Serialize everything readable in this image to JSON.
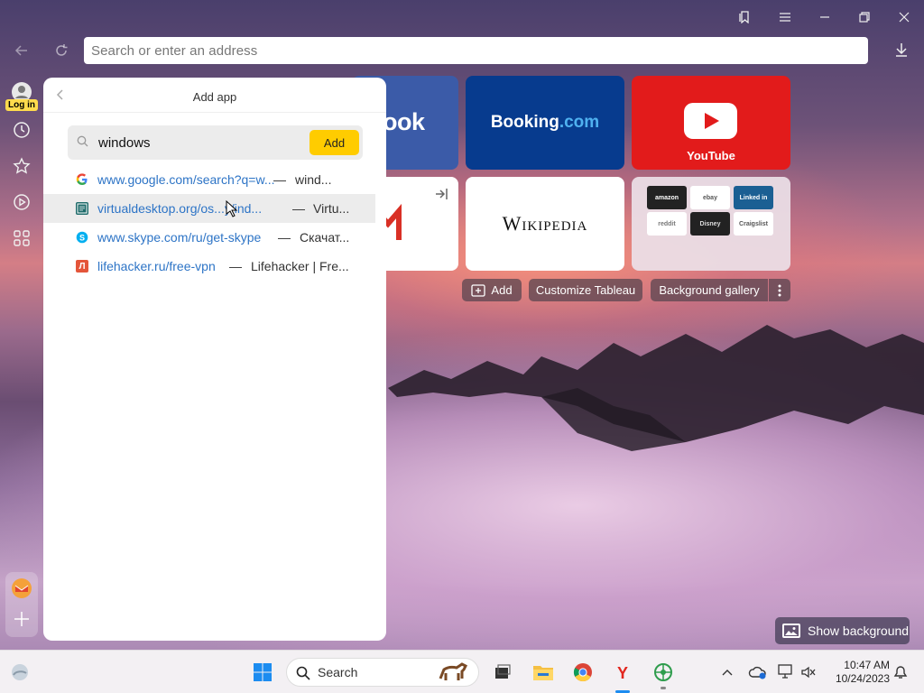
{
  "browser": {
    "address_placeholder": "Search or enter an address"
  },
  "sidebar": {
    "login_label": "Log in"
  },
  "tiles": {
    "facebook_text": "ook",
    "booking_main": "Booking",
    "booking_suffix": ".com",
    "youtube_label": "YouTube",
    "wikipedia_text": "Wikipedia",
    "multi": [
      "amazon",
      "ebay",
      "Linked in",
      "reddit",
      "Disney",
      "Craigslist"
    ]
  },
  "tableau": {
    "add_label": "Add",
    "customize_label": "Customize Tableau",
    "gallery_label": "Background gallery"
  },
  "panel": {
    "title": "Add app",
    "search_value": "windows",
    "add_button": "Add",
    "suggestions": [
      {
        "url": "www.google.com/search?q=w...",
        "desc": "wind..."
      },
      {
        "url": "virtualdesktop.org/os...y/ind...",
        "desc": "Virtu..."
      },
      {
        "url": "www.skype.com/ru/get-skype",
        "desc": "Скачат..."
      },
      {
        "url": "lifehacker.ru/free-vpn",
        "desc": "Lifehacker | Fre..."
      }
    ]
  },
  "show_background": "Show background",
  "taskbar": {
    "search_label": "Search",
    "time": "10:47 AM",
    "date": "10/24/2023"
  },
  "colors": {
    "accent_yellow": "#ffcc00",
    "link_blue": "#2d74c6",
    "youtube_red": "#e21b1b",
    "booking_blue": "#073b8e",
    "facebook_blue": "#3b5ba8"
  }
}
